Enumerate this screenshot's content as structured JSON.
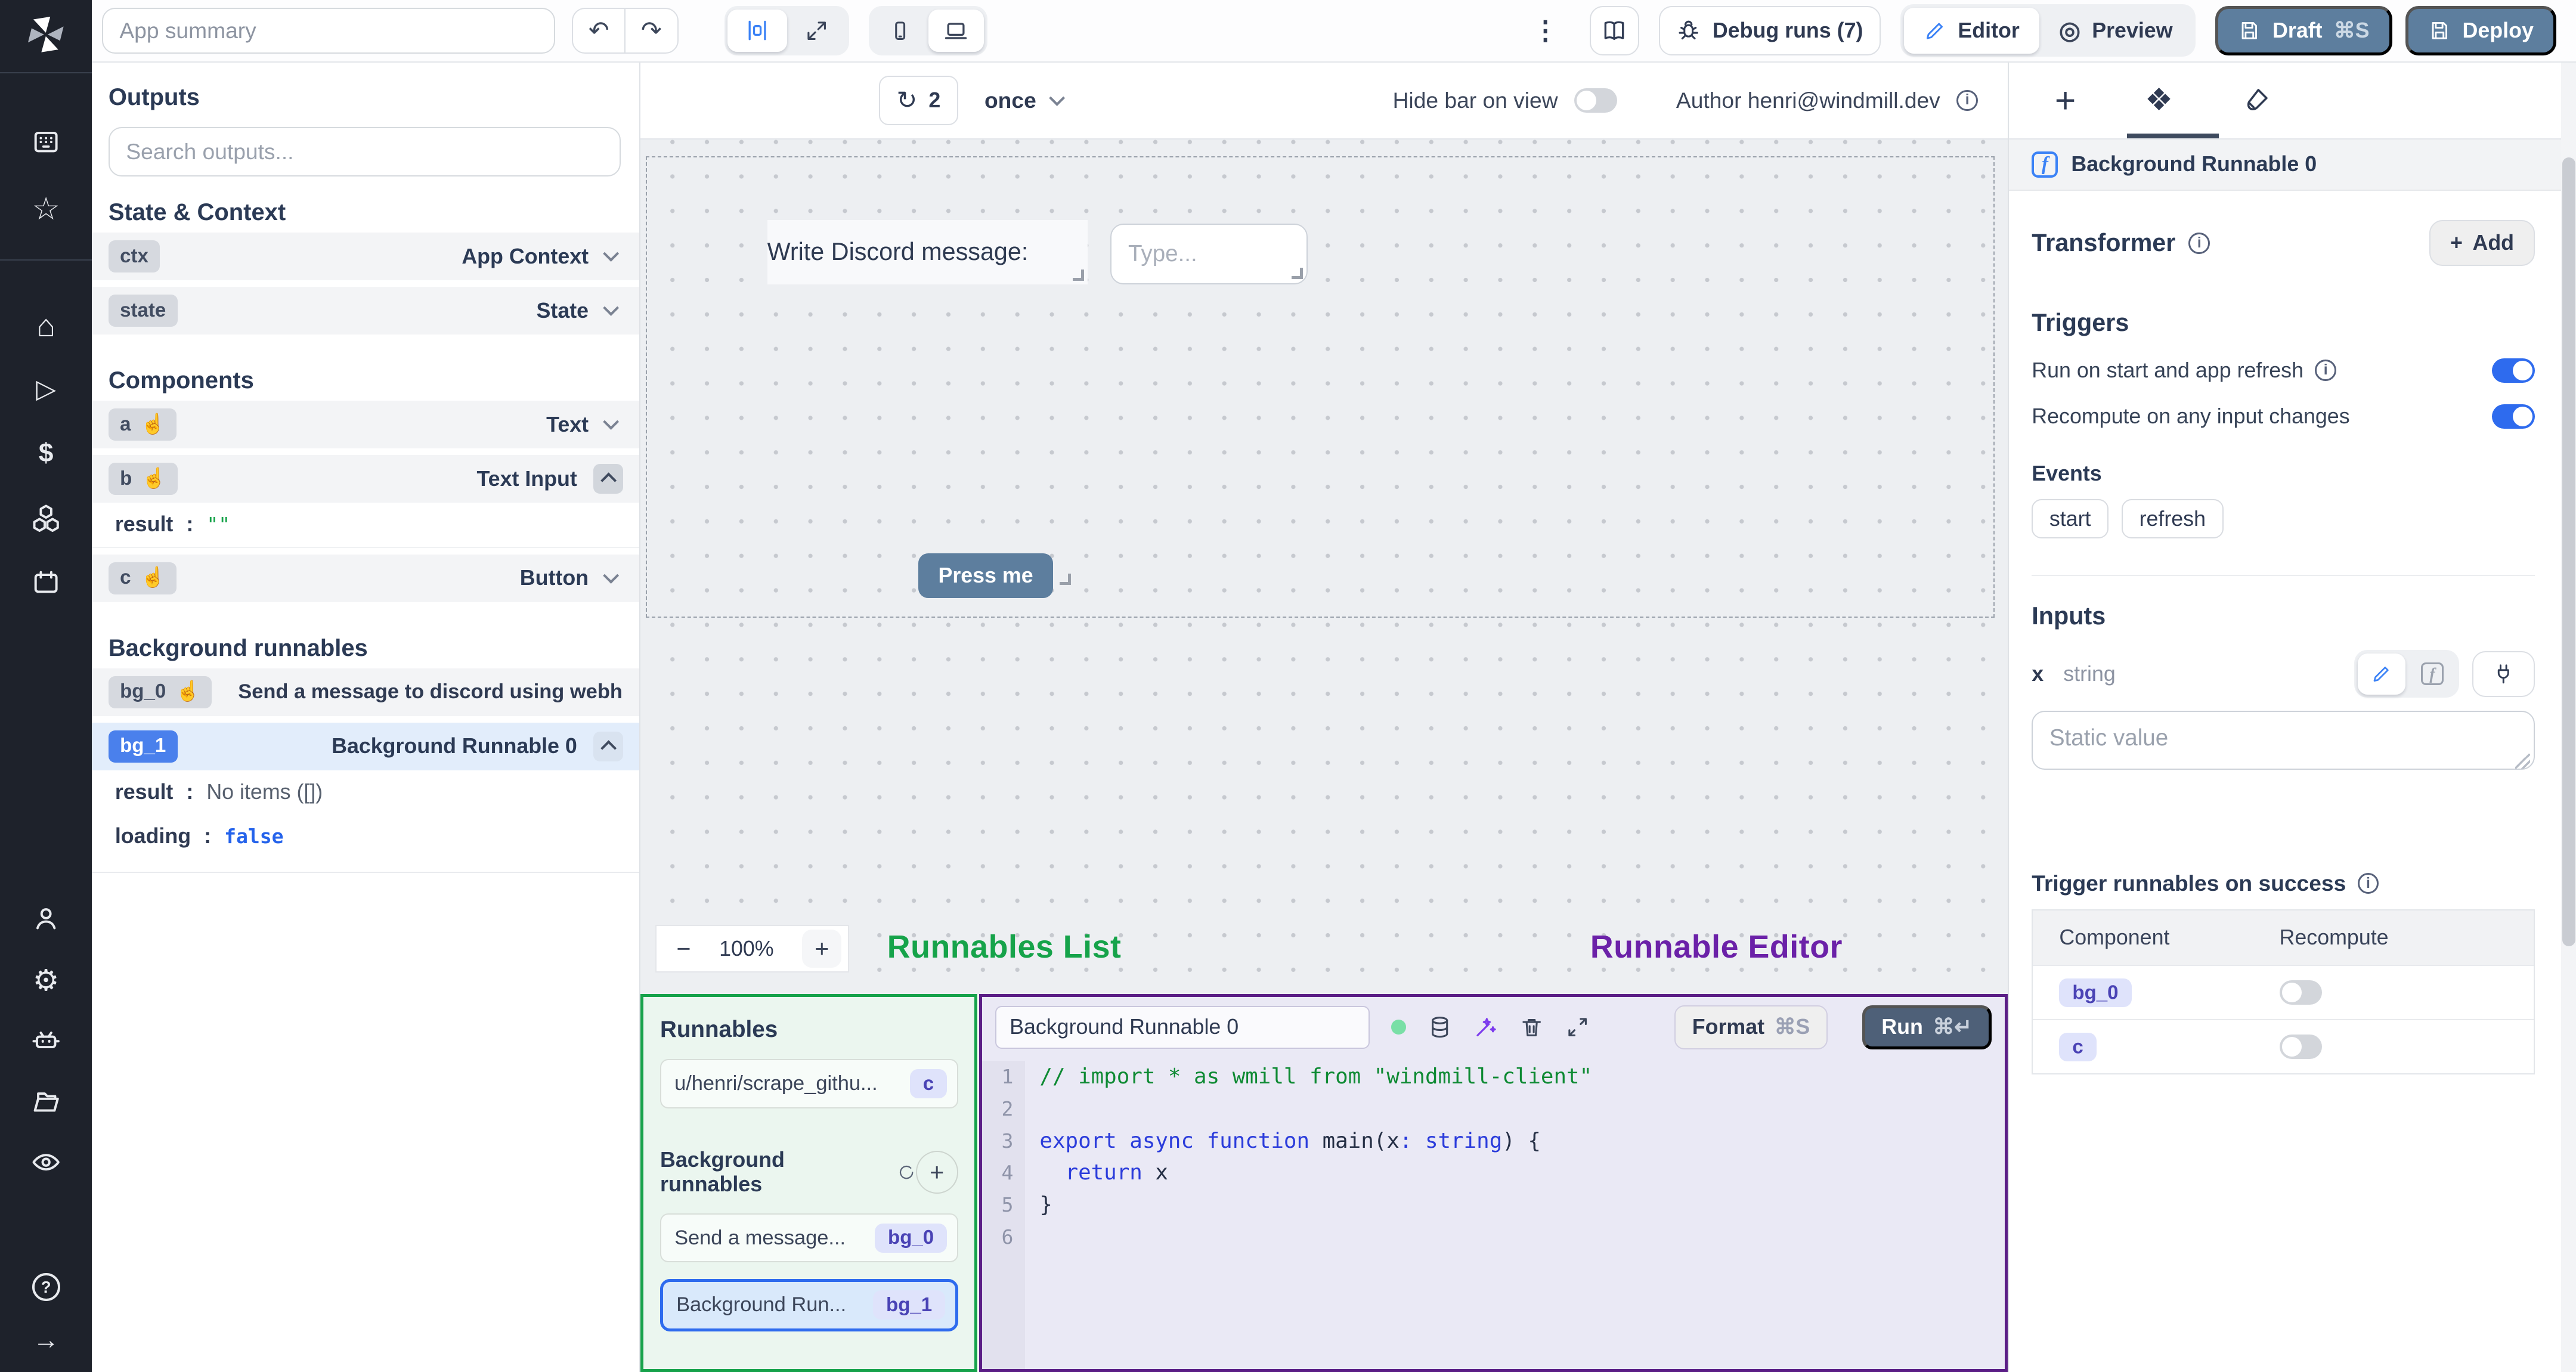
{
  "icons": {
    "undo": "↶",
    "redo": "↷",
    "kebab": "⋮",
    "preview_eye": "◎",
    "refresh": "↻",
    "star": "☆",
    "home": "⌂",
    "play": "▷",
    "dollar": "$",
    "gear": "⚙",
    "help": "?",
    "arrow_right": "→",
    "hand": "☝",
    "diamonds": "❖",
    "minus": "−",
    "plus": "+",
    "info": "i",
    "f": "f"
  },
  "topbar": {
    "app_summary_placeholder": "App summary",
    "debug_runs": "Debug runs (7)",
    "editor": "Editor",
    "preview": "Preview",
    "draft": "Draft",
    "draft_shortcut": "⌘S",
    "deploy": "Deploy"
  },
  "center_toolbar": {
    "refresh_count": "2",
    "interval": "once",
    "hide_bar": "Hide bar on view",
    "author": "Author henri@windmill.dev"
  },
  "left_panel": {
    "title": "Outputs",
    "search_placeholder": "Search outputs...",
    "state_context_heading": "State & Context",
    "ctx_id": "ctx",
    "ctx_type": "App Context",
    "state_id": "state",
    "state_type": "State",
    "components_heading": "Components",
    "a_id": "a",
    "a_type": "Text",
    "b_id": "b",
    "b_type": "Text Input",
    "b_result_key": "result",
    "b_result_value": "\"\"",
    "c_id": "c",
    "c_type": "Button",
    "background_heading": "Background runnables",
    "bg0_id": "bg_0",
    "bg0_label": "Send a message to discord using webhoo",
    "bg1_id": "bg_1",
    "bg1_label": "Background Runnable 0",
    "bg1_result_key": "result",
    "bg1_result_value": "No items ([])",
    "bg1_loading_key": "loading",
    "bg1_loading_value": "false"
  },
  "canvas": {
    "label_text": "Write Discord message:",
    "input_placeholder": "Type...",
    "button_label": "Press me",
    "zoom_level": "100%"
  },
  "annotations": {
    "runnables_list": "Runnables List",
    "runnable_editor": "Runnable Editor"
  },
  "runnables_panel": {
    "title": "Runnables",
    "item_path": "u/henri/scrape_githu...",
    "item_path_badge": "c",
    "background_heading": "Background runnables",
    "item_bg0": "Send a message...",
    "item_bg0_badge": "bg_0",
    "item_bg1": "Background Run...",
    "item_bg1_badge": "bg_1"
  },
  "editor_panel": {
    "name_value": "Background Runnable 0",
    "format_label": "Format",
    "format_shortcut": "⌘S",
    "run_label": "Run",
    "run_shortcut": "⌘↵",
    "code": {
      "lines": [
        {
          "n": "1",
          "tokens": [
            {
              "c": "cmt",
              "t": "// import * as wmill from \"windmill-client\""
            }
          ]
        },
        {
          "n": "2",
          "tokens": []
        },
        {
          "n": "3",
          "tokens": [
            {
              "c": "kw",
              "t": "export async function "
            },
            {
              "c": "pl",
              "t": "main(x"
            },
            {
              "c": "kw",
              "t": ": string"
            },
            {
              "c": "pl",
              "t": ") {"
            }
          ]
        },
        {
          "n": "4",
          "tokens": [
            {
              "c": "kw",
              "t": "  return"
            },
            {
              "c": "pl",
              "t": " x"
            }
          ]
        },
        {
          "n": "5",
          "tokens": [
            {
              "c": "pl",
              "t": "}"
            }
          ]
        },
        {
          "n": "6",
          "tokens": []
        }
      ]
    }
  },
  "right_panel": {
    "header_title": "Background Runnable 0",
    "transformer_label": "Transformer",
    "add_label": "Add",
    "triggers_label": "Triggers",
    "run_on_start": "Run on start and app refresh",
    "recompute": "Recompute on any input changes",
    "events_label": "Events",
    "chip_start": "start",
    "chip_refresh": "refresh",
    "inputs_label": "Inputs",
    "input_name": "x",
    "input_type": "string",
    "static_placeholder": "Static value",
    "trigger_success": "Trigger runnables on success",
    "col_component": "Component",
    "col_recompute": "Recompute",
    "row1_badge": "bg_0",
    "row2_badge": "c"
  },
  "colors": {
    "accent_blue": "#2e6bee",
    "slate_button": "#5d7e9e",
    "green_annotation": "#16a34a",
    "purple_annotation": "#6b21a8",
    "indigo_badge": "#4a43b5",
    "run_button": "#4e6078"
  }
}
